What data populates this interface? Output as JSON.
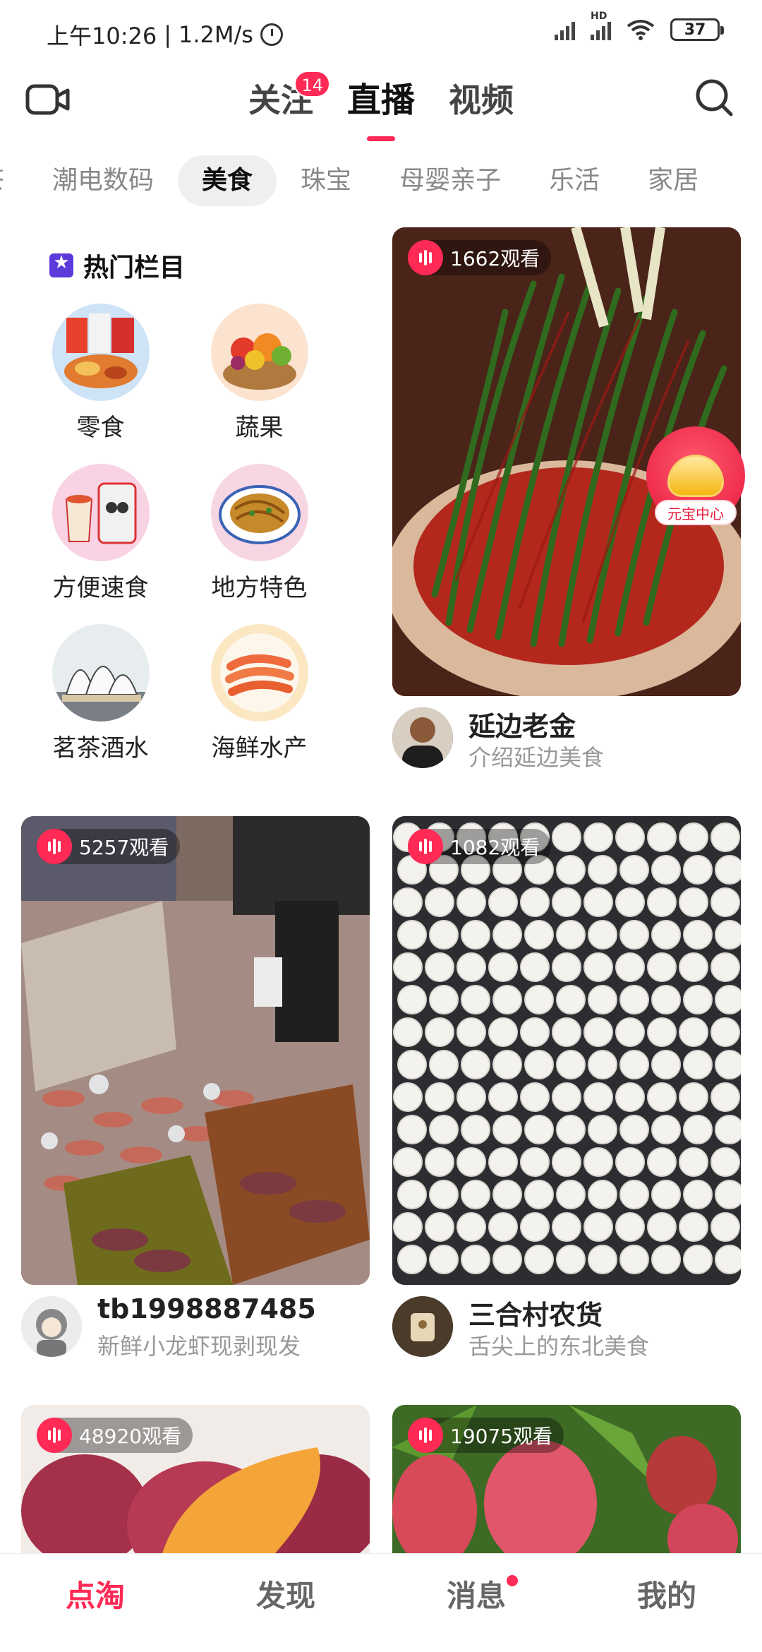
{
  "status_bar": {
    "time": "上午10:26",
    "speed": "1.2M/s",
    "battery": "37",
    "network_label": "HD"
  },
  "header": {
    "tabs": [
      {
        "label": "关注",
        "badge": "14"
      },
      {
        "label": "直播"
      },
      {
        "label": "视频"
      }
    ],
    "active_tab": "直播"
  },
  "categories": [
    "茶",
    "潮电数码",
    "美食",
    "珠宝",
    "母婴亲子",
    "乐活",
    "家居"
  ],
  "active_category": "美食",
  "hot": {
    "title": "热门栏目",
    "items": [
      {
        "label": "零食"
      },
      {
        "label": "蔬果"
      },
      {
        "label": "方便速食"
      },
      {
        "label": "地方特色"
      },
      {
        "label": "茗茶酒水"
      },
      {
        "label": "海鲜水产"
      }
    ]
  },
  "cards": [
    {
      "viewers": "1662观看",
      "name": "延边老金",
      "desc": "介绍延边美食"
    },
    {
      "viewers": "5257观看",
      "name": "tb1998887485",
      "desc": "新鲜小龙虾现剥现发"
    },
    {
      "viewers": "1082观看",
      "name": "三合村农货",
      "desc": "舌尖上的东北美食"
    },
    {
      "viewers": "48920观看",
      "name": "",
      "desc": ""
    },
    {
      "viewers": "19075观看",
      "name": "",
      "desc": ""
    }
  ],
  "yuanbao": {
    "label": "元宝中心"
  },
  "bottom_nav": [
    "点淘",
    "发现",
    "消息",
    "我的"
  ],
  "colors": {
    "accent": "#ff2a55",
    "text": "#222222",
    "muted": "#999999"
  }
}
